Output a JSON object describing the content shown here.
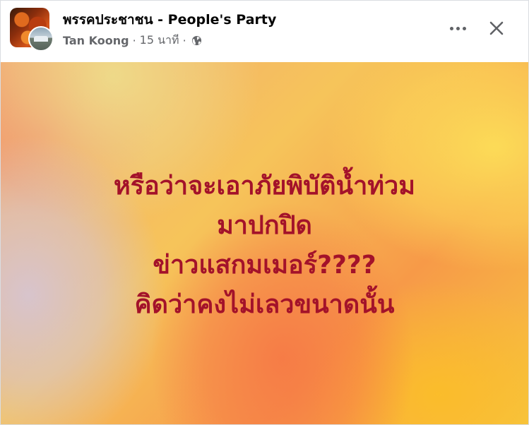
{
  "post": {
    "group_name": "พรรคประชาชน - People's Party",
    "author": "Tan Koong",
    "separator": "·",
    "time": "15 นาที",
    "separator2": "·",
    "privacy_icon": "globe-icon",
    "actions": {
      "more_icon": "more-icon",
      "close_icon": "close-icon"
    },
    "text_lines": [
      "หรือว่าจะเอาภัยพิบัติน้ำท่วม",
      "มาปกปิด",
      "ข่าวแสกมเมอร์????",
      "คิดว่าคงไม่เลวขนาดนั้น"
    ],
    "text_color": "#a3122a"
  }
}
